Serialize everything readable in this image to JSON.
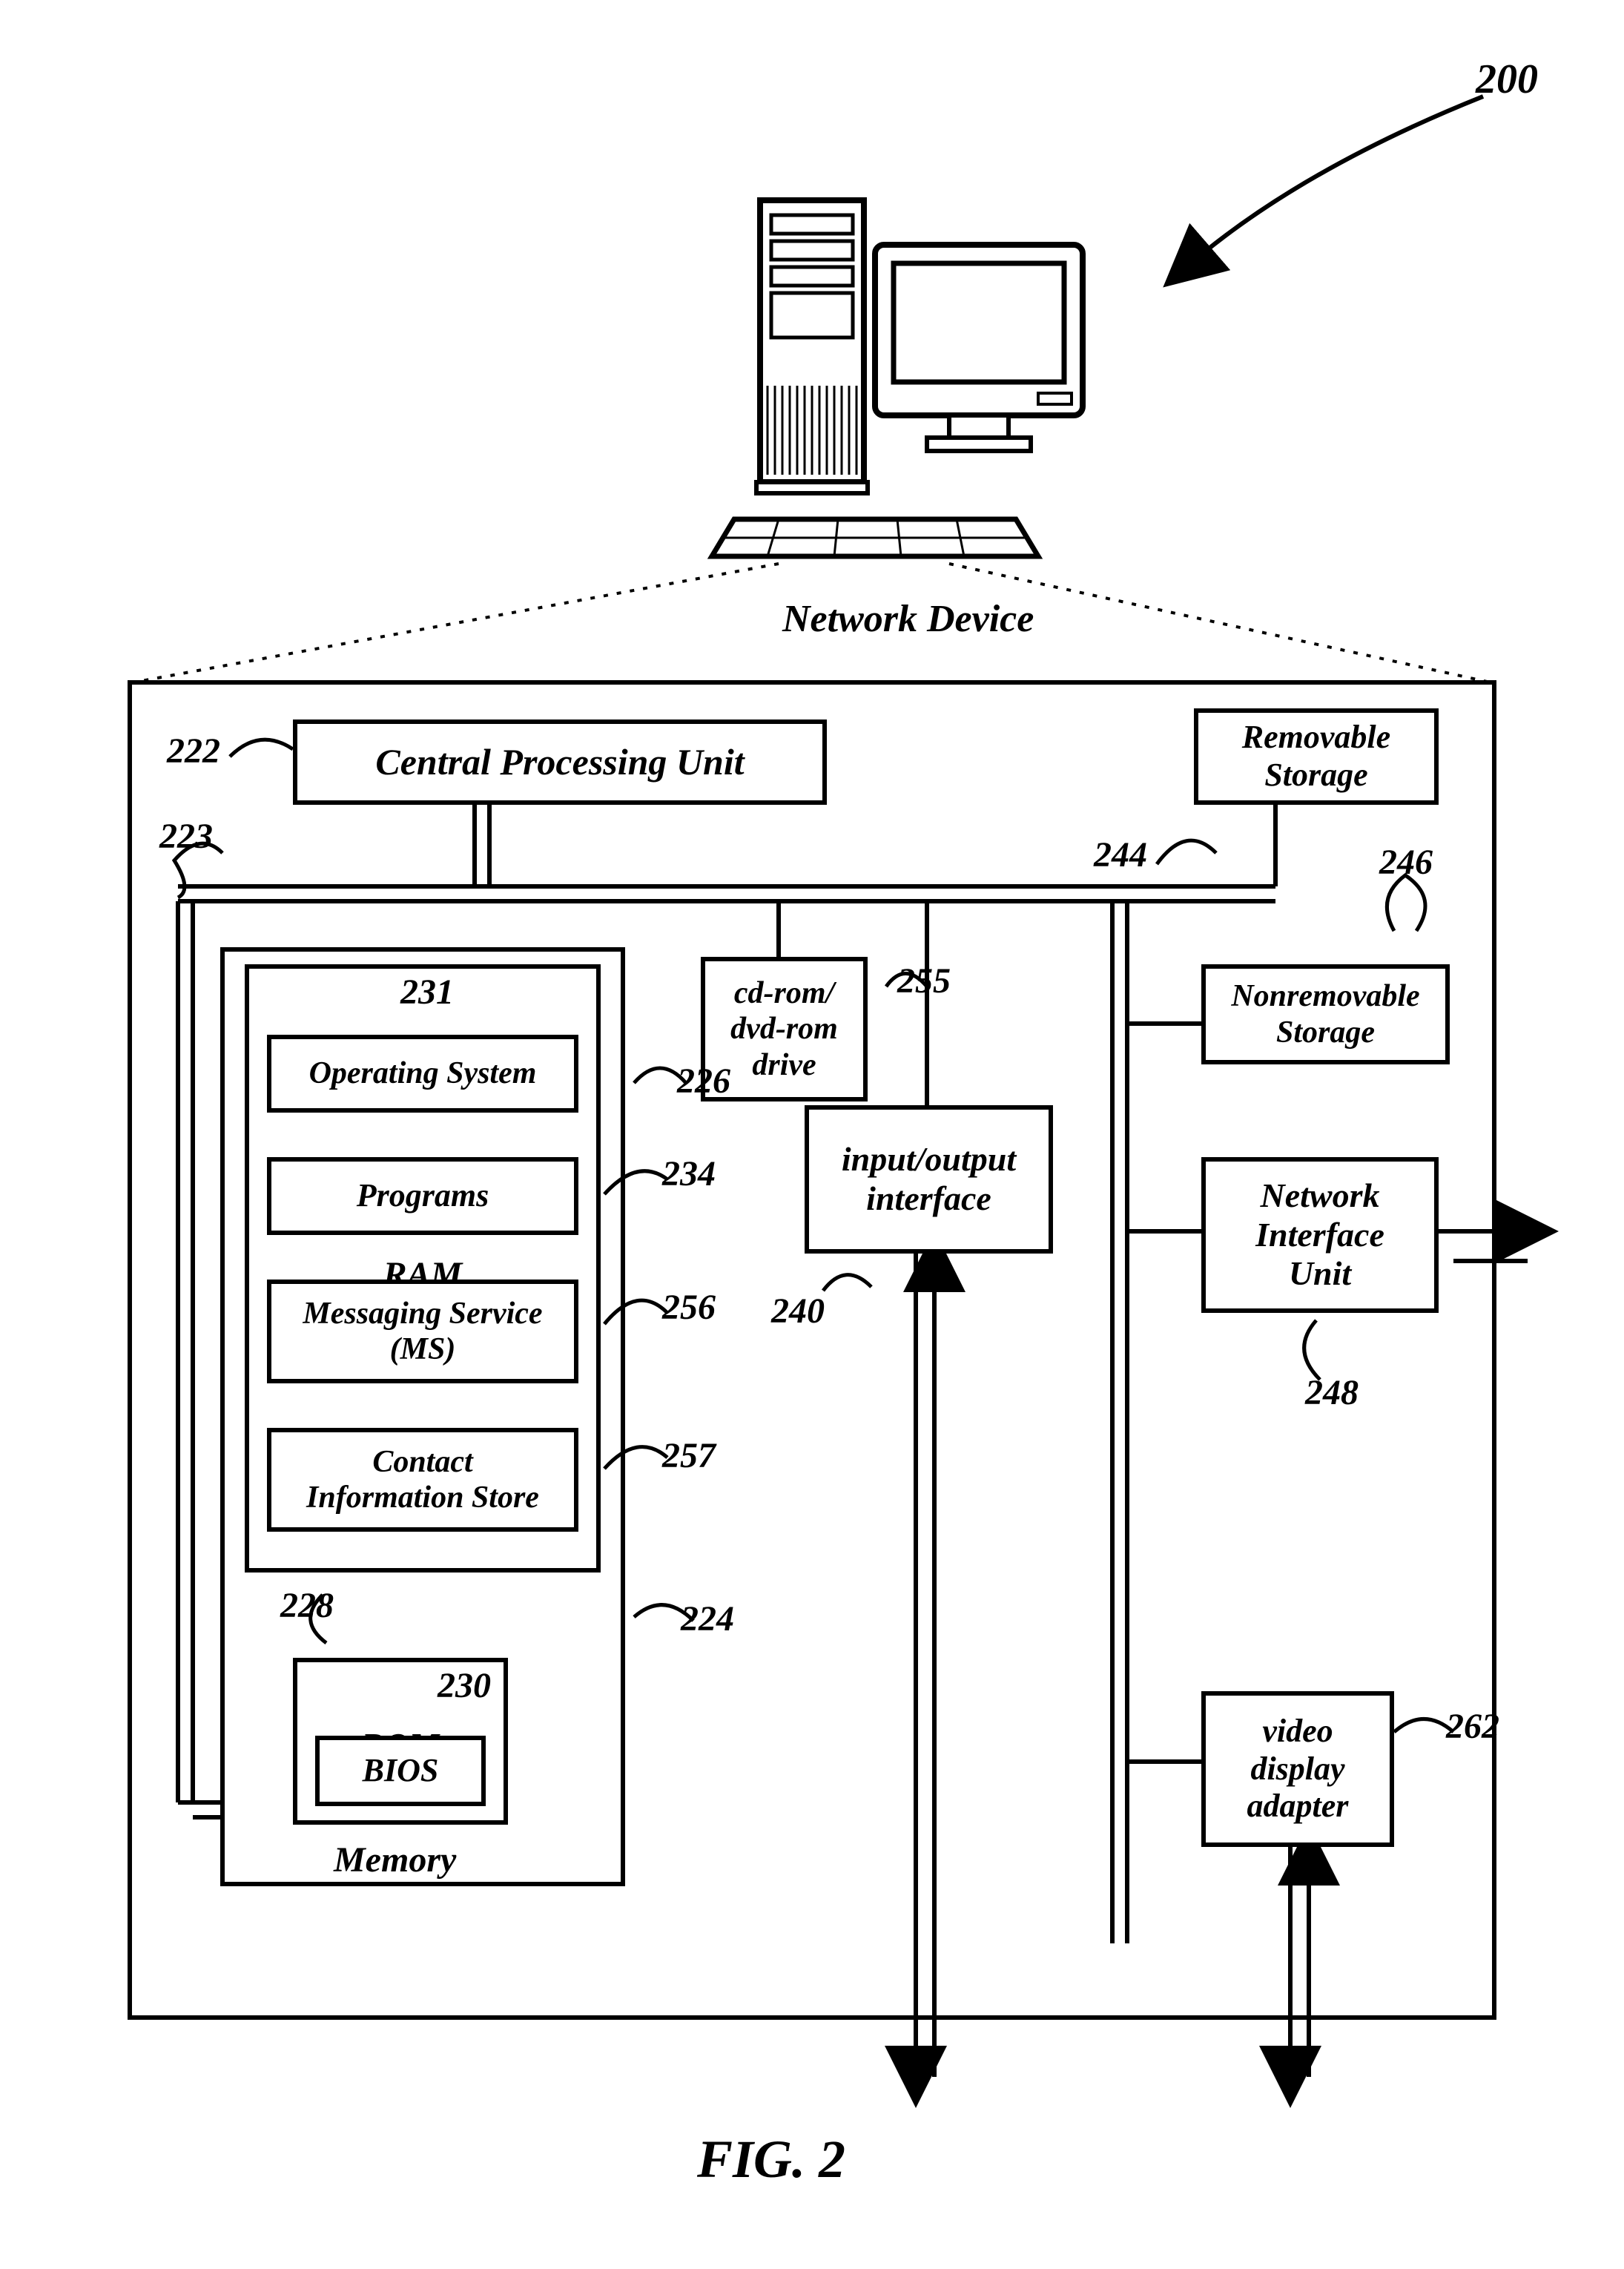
{
  "figure": {
    "reference": "200",
    "title": "FIG. 2",
    "device_label": "Network Device"
  },
  "blocks": {
    "cpu": {
      "label": "Central Processing Unit",
      "ref": "222"
    },
    "bus": {
      "ref": "223"
    },
    "removable_storage": {
      "label": "Removable\nStorage",
      "ref": "244"
    },
    "nonremovable_storage": {
      "label": "Nonremovable\nStorage",
      "ref": "246"
    },
    "cdrom": {
      "label": "cd-rom/\ndvd-rom\ndrive",
      "ref": "226"
    },
    "io_interface": {
      "label": "input/output\ninterface",
      "ref": "240",
      "ref2": "255"
    },
    "niu": {
      "label": "Network\nInterface\nUnit",
      "ref": "248"
    },
    "video": {
      "label": "video\ndisplay\nadapter",
      "ref": "262"
    },
    "memory": {
      "label": "Memory",
      "ref": "224"
    },
    "ram": {
      "label": "RAM",
      "ref": "228"
    },
    "os": {
      "label": "Operating System",
      "ref": "231"
    },
    "programs": {
      "label": "Programs",
      "ref": "234"
    },
    "ms": {
      "label": "Messaging Service\n(MS)",
      "ref": "256"
    },
    "contact_store": {
      "label": "Contact\nInformation Store",
      "ref": "257"
    },
    "rom": {
      "label": "ROM",
      "ref": "230"
    },
    "bios": {
      "label": "BIOS"
    }
  }
}
